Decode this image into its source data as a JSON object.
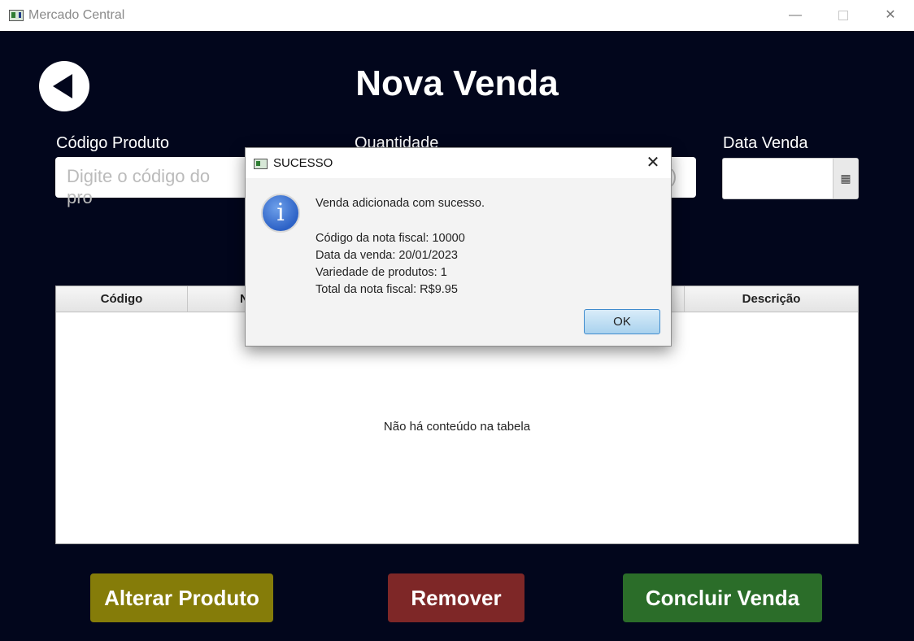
{
  "window": {
    "title": "Mercado Central",
    "minimize_glyph": "—",
    "close_glyph": "✕"
  },
  "page": {
    "title": "Nova Venda"
  },
  "form": {
    "codigo_label": "Código Produto",
    "codigo_placeholder": "Digite o código do pro",
    "quantidade_label": "Quantidade",
    "quantidade_visible_tail": "s)",
    "data_label": "Data Venda",
    "data_value": "",
    "calendar_icon": "calendar-icon"
  },
  "table": {
    "columns": [
      "Código",
      "N",
      "Descrição"
    ],
    "empty_message": "Não há conteúdo na tabela"
  },
  "buttons": {
    "alterar": "Alterar Produto",
    "remover": "Remover",
    "concluir": "Concluir Venda"
  },
  "dialog": {
    "title": "SUCESSO",
    "close_glyph": "✕",
    "icon": "i",
    "message_heading": "Venda adicionada com sucesso.",
    "lines": [
      "Código da nota fiscal: 10000",
      "Data da venda: 20/01/2023",
      "Variedade de produtos: 1",
      "Total da nota fiscal: R$9.95"
    ],
    "ok_label": "OK"
  },
  "colors": {
    "background": "#02061c",
    "alterar": "#857c09",
    "remover": "#7e2727",
    "concluir": "#2b6d29"
  }
}
